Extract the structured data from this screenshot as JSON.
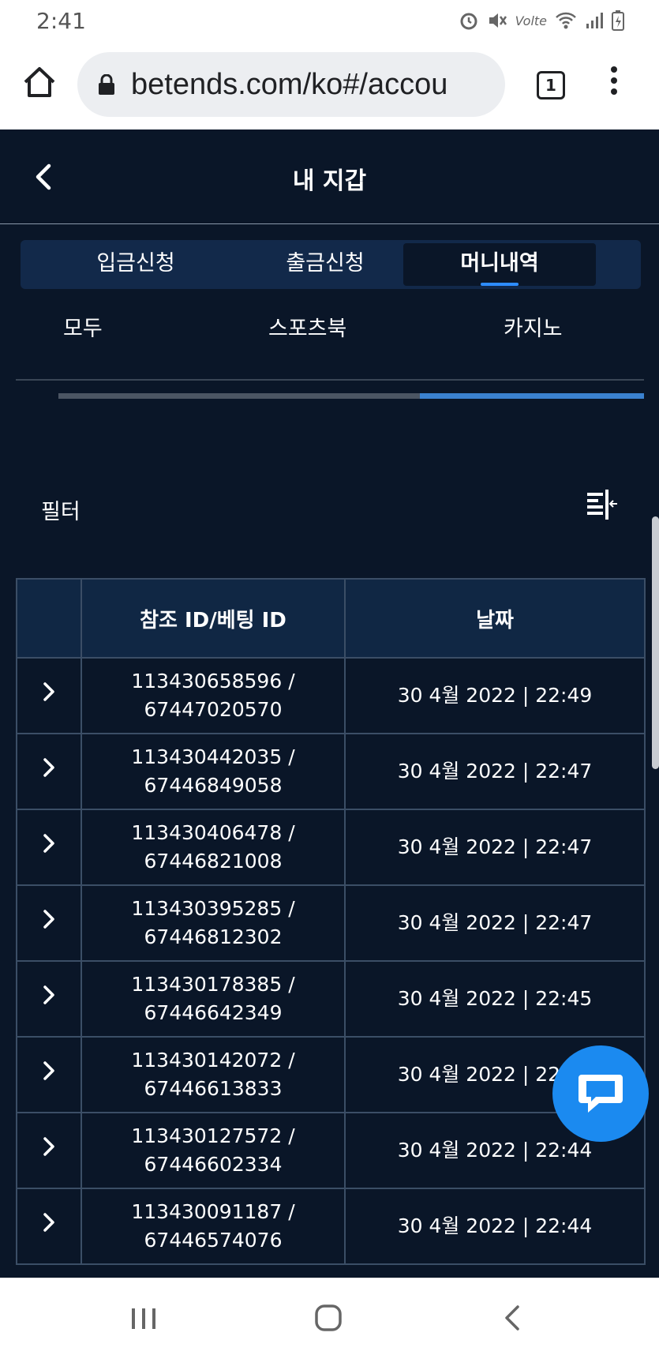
{
  "status": {
    "time": "2:41",
    "network": "Volte"
  },
  "browser": {
    "url": "betends.com/ko#/accou",
    "tab_count": "1"
  },
  "header": {
    "title": "내 지갑"
  },
  "segments": [
    {
      "label": "입금신청",
      "active": false
    },
    {
      "label": "출금신청",
      "active": false
    },
    {
      "label": "머니내역",
      "active": true
    }
  ],
  "subtabs": [
    {
      "label": "모두"
    },
    {
      "label": "스포츠북"
    },
    {
      "label": "카지노",
      "active": true
    }
  ],
  "filter": {
    "label": "필터"
  },
  "table": {
    "headers": [
      "",
      "참조 ID/베팅 ID",
      "날짜"
    ],
    "rows": [
      {
        "ref": "113430658596 /",
        "bet": "67447020570",
        "date": "30 4월 2022 | 22:49"
      },
      {
        "ref": "113430442035 /",
        "bet": "67446849058",
        "date": "30 4월 2022 | 22:47"
      },
      {
        "ref": "113430406478 /",
        "bet": "67446821008",
        "date": "30 4월 2022 | 22:47"
      },
      {
        "ref": "113430395285 /",
        "bet": "67446812302",
        "date": "30 4월 2022 | 22:47"
      },
      {
        "ref": "113430178385 /",
        "bet": "67446642349",
        "date": "30 4월 2022 | 22:45"
      },
      {
        "ref": "113430142072 /",
        "bet": "67446613833",
        "date": "30 4월 2022 | 22:44"
      },
      {
        "ref": "113430127572 /",
        "bet": "67446602334",
        "date": "30 4월 2022 | 22:44"
      },
      {
        "ref": "113430091187 /",
        "bet": "67446574076",
        "date": "30 4월 2022 | 22:44"
      }
    ]
  },
  "colors": {
    "background": "#0a1628",
    "accent": "#2d8cff",
    "chat": "#1b8af0"
  },
  "icons": [
    "home-icon",
    "lock-icon",
    "menu-icon",
    "back-icon",
    "filter-icon",
    "chevron-right-icon",
    "chat-icon",
    "recent-apps-icon",
    "home-nav-icon",
    "back-nav-icon"
  ]
}
